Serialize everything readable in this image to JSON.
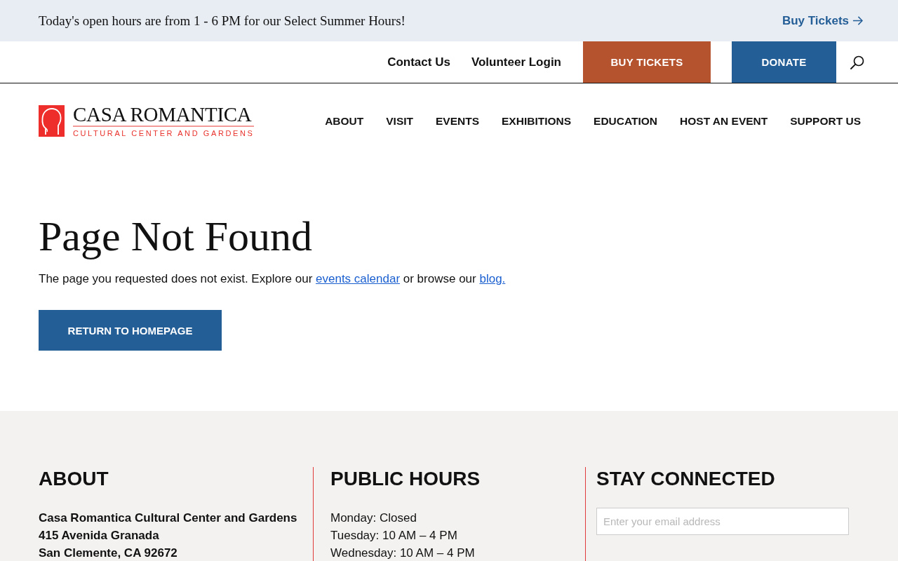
{
  "announcement": {
    "text": "Today's open hours are from 1 - 6 PM for our Select Summer Hours!",
    "link": "Buy Tickets"
  },
  "utility_nav": {
    "links": [
      "Contact Us",
      "Volunteer Login"
    ],
    "buttons": [
      {
        "label": "BUY TICKETS",
        "kind": "accent"
      },
      {
        "label": "DONATE",
        "kind": "primary"
      }
    ]
  },
  "logo": {
    "title": "CASA ROMANTICA",
    "subtitle": "CULTURAL CENTER AND GARDENS"
  },
  "main_nav": [
    "ABOUT",
    "VISIT",
    "EVENTS",
    "EXHIBITIONS",
    "EDUCATION",
    "HOST AN EVENT",
    "SUPPORT US"
  ],
  "content": {
    "title": "Page Not Found",
    "message": [
      {
        "kind": "text",
        "text": "The page you requested does not exist. Explore our "
      },
      {
        "kind": "link",
        "text": "events calendar"
      },
      {
        "kind": "text",
        "text": " or browse our "
      },
      {
        "kind": "link",
        "text": "blog."
      }
    ],
    "button": "RETURN TO HOMEPAGE"
  },
  "footer": {
    "columns": [
      {
        "kind": "address",
        "title": "ABOUT",
        "lines": [
          "Casa Romantica Cultural Center and Gardens",
          "415 Avenida Granada",
          "San Clemente, CA 92672"
        ]
      },
      {
        "kind": "hours",
        "title": "PUBLIC HOURS",
        "lines": [
          "Monday: Closed",
          "Tuesday: 10 AM – 4 PM",
          "Wednesday: 10 AM – 4 PM"
        ]
      },
      {
        "kind": "signup",
        "title": "STAY CONNECTED",
        "placeholder": "Enter your email address"
      }
    ]
  }
}
